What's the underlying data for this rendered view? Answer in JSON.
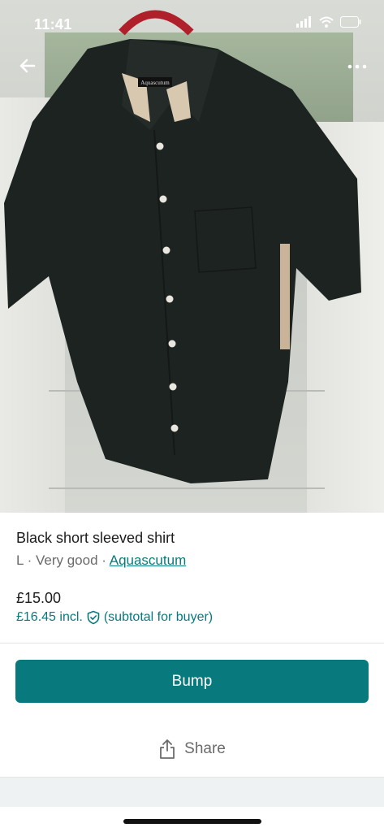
{
  "status_bar": {
    "time": "11:41"
  },
  "listing": {
    "title": "Black short sleeved shirt",
    "size": "L",
    "separator": "·",
    "condition": "Very good",
    "brand": "Aquascutum",
    "price": "£15.00",
    "price_incl": "£16.45 incl.",
    "price_incl_note": "(subtotal for buyer)"
  },
  "actions": {
    "bump_label": "Bump",
    "share_label": "Share"
  },
  "photo": {
    "label_text": "Aquascutum"
  },
  "colors": {
    "accent": "#087a7d",
    "shirt": "#1d2321"
  }
}
